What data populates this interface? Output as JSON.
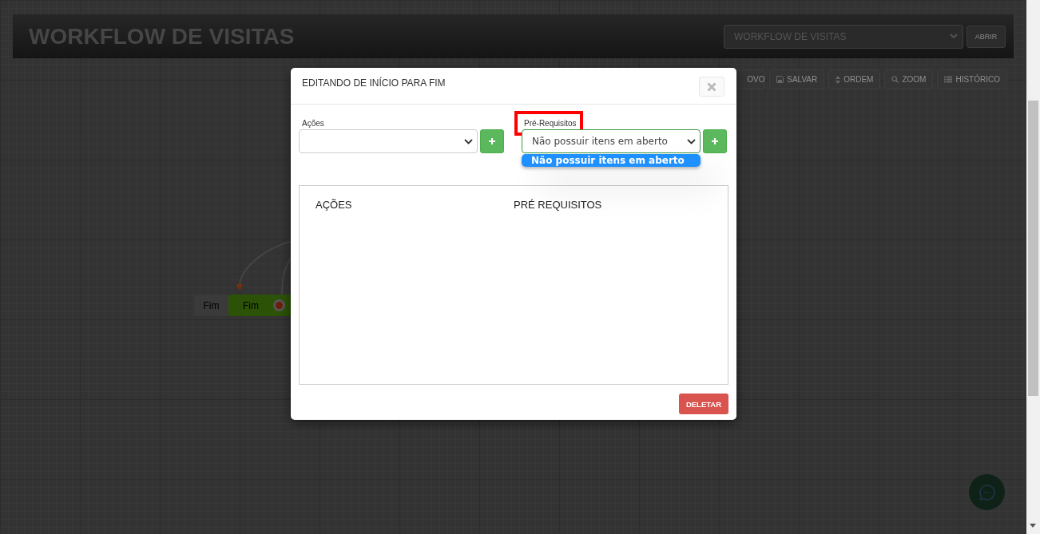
{
  "page": {
    "title": "WORKFLOW DE VISITAS",
    "workflow_select": {
      "value": "WORKFLOW DE VISITAS"
    },
    "open_button": "ABRIR"
  },
  "toolbar": [
    {
      "kind": "new",
      "label": "OVO"
    },
    {
      "kind": "save",
      "label": "SALVAR"
    },
    {
      "kind": "order",
      "label": "ORDEM"
    },
    {
      "kind": "zoom",
      "label": "ZOOM"
    },
    {
      "kind": "history",
      "label": "HISTÓRICO"
    }
  ],
  "canvas": {
    "nodes": [
      {
        "label": "Fim",
        "color": "#3a3a3a",
        "end_marker": false
      },
      {
        "label": "Fim",
        "color": "#2c5208",
        "end_marker": true
      }
    ]
  },
  "modal": {
    "title": "EDITANDO DE INÍCIO PARA FIM",
    "fields": [
      {
        "label": "Ações",
        "highlighted": false,
        "focused": false
      },
      {
        "label": "Pré-Requisitos",
        "value": "Não possuir itens em aberto",
        "highlighted": true,
        "focused": true,
        "options": [
          {
            "label": "Não possuir itens em aberto",
            "selected": true
          }
        ]
      }
    ],
    "columns": [
      "AÇÕES",
      "PRÉ REQUISITOS"
    ],
    "delete_button": "DELETAR"
  }
}
